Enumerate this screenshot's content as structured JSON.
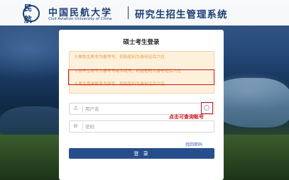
{
  "header": {
    "logo_glyph": "民航",
    "university_cn": "中国民航大学",
    "university_en": "Civil Aviation University of China",
    "system_title": "研究生招生管理系统"
  },
  "login": {
    "title": "硕士考生登录",
    "notices": [
      {
        "icon": "pin-icon",
        "text": "推免生账号为报考号，初始密码为身份证后六位"
      },
      {
        "icon": "pin-icon",
        "text": "统考生账号为报考号或手机号，初始密码为身份证后六位"
      },
      {
        "icon": "pin-icon",
        "text": "考生登录账号为学号，初始密码为身份证后六位"
      }
    ],
    "username": {
      "icon": "user-icon",
      "placeholder": "用户名",
      "value": ""
    },
    "password": {
      "icon": "lock-icon",
      "placeholder": "密码",
      "value": ""
    },
    "query_hint": "点击可查询账号",
    "forgot_password": "找回密码",
    "login_button": "登 录"
  },
  "colors": {
    "brand": "#1c3f73",
    "button": "#274e8c",
    "notice_bg": "#fdf1dc",
    "notice_text": "#e59a45",
    "highlight": "#d0101b"
  }
}
